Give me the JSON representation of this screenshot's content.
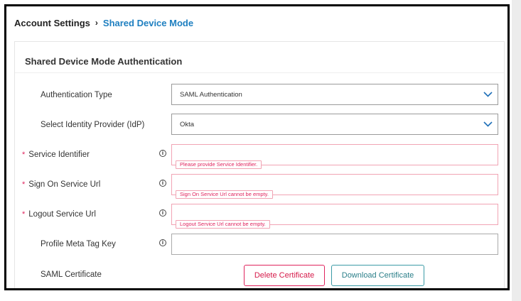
{
  "breadcrumb": {
    "root": "Account Settings",
    "separator": "›",
    "current": "Shared Device Mode"
  },
  "section": {
    "title": "Shared Device Mode Authentication"
  },
  "icons": {
    "chevron": "chevron-down-icon",
    "info": "info-icon",
    "required": "required-asterisk"
  },
  "colors": {
    "accent": "#1e7fc0",
    "error": "#e0245e",
    "teal": "#3b9ba6"
  },
  "fields": {
    "authentication_type": {
      "label": "Authentication Type",
      "value": "SAML Authentication"
    },
    "identity_provider": {
      "label": "Select Identity Provider (IdP)",
      "value": "Okta"
    },
    "service_identifier": {
      "label": "Service Identifier",
      "required_mark": "*",
      "info": "i",
      "error": "Please provide Service Identifier."
    },
    "sign_on_url": {
      "label": "Sign On Service Url",
      "required_mark": "*",
      "info": "i",
      "error": "Sign On Service Url cannot be empty."
    },
    "logout_url": {
      "label": "Logout Service Url",
      "required_mark": "*",
      "info": "i",
      "error": "Logout Service Url cannot be empty."
    },
    "profile_meta_tag_key": {
      "label": "Profile Meta Tag Key",
      "info": "i"
    },
    "saml_certificate": {
      "label": "SAML Certificate"
    }
  },
  "buttons": {
    "delete_certificate": "Delete Certificate",
    "download_certificate": "Download Certificate"
  }
}
